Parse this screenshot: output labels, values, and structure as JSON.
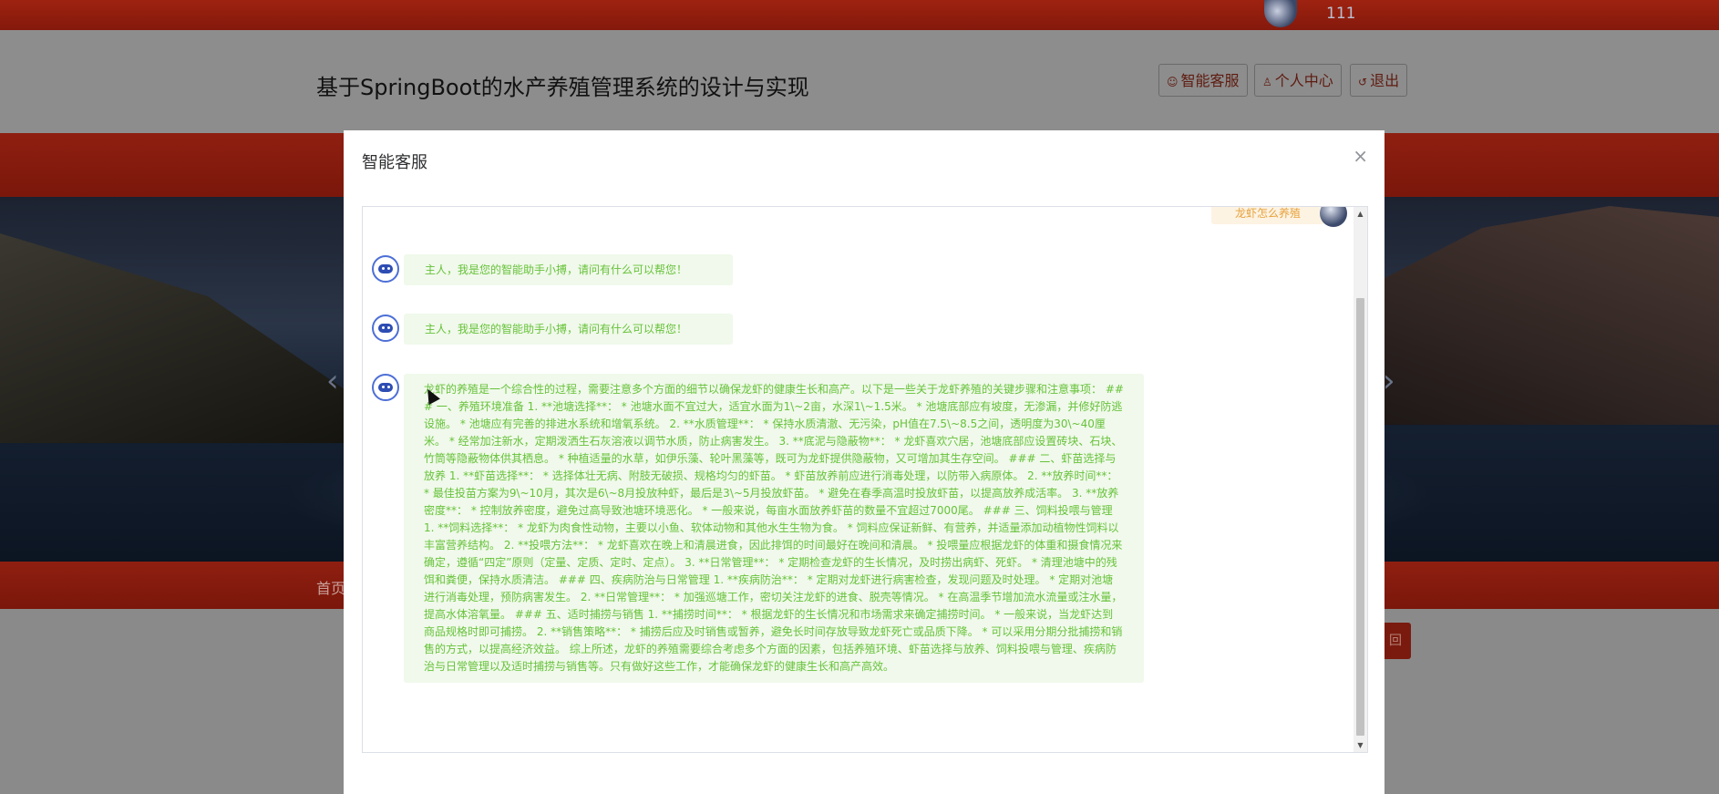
{
  "topbar": {
    "username": "111"
  },
  "header": {
    "site_title": "基于SpringBoot的水产养殖管理系统的设计与实现",
    "buttons": [
      {
        "icon": "person-icon",
        "label": "智能客服"
      },
      {
        "icon": "user-icon",
        "label": "个人中心"
      },
      {
        "icon": "logout-icon",
        "label": "退出"
      }
    ]
  },
  "nav": {
    "home": "首页"
  },
  "page": {
    "return_label": "回"
  },
  "modal": {
    "title": "智能客服",
    "close_glyph": "×",
    "user_message": "龙虾怎么养殖",
    "bot_messages": [
      "主人，我是您的智能助手小搏，请问有什么可以帮您！",
      "主人，我是您的智能助手小搏，请问有什么可以帮您！",
      "龙虾的养殖是一个综合性的过程，需要注意多个方面的细节以确保龙虾的健康生长和高产。以下是一些关于龙虾养殖的关键步骤和注意事项： ### 一、养殖环境准备 1. **池塘选择**： * 池塘水面不宜过大，适宜水面为1\\~2亩，水深1\\~1.5米。 * 池塘底部应有坡度，无渗漏，并修好防逃设施。 * 池塘应有完善的排进水系统和增氧系统。 2. **水质管理**： * 保持水质清澈、无污染，pH值在7.5\\~8.5之间，透明度为30\\~40厘米。 * 经常加注新水，定期泼洒生石灰溶液以调节水质，防止病害发生。 3. **底泥与隐蔽物**： * 龙虾喜欢穴居，池塘底部应设置砖块、石块、竹筒等隐蔽物体供其栖息。 * 种植适量的水草，如伊乐藻、轮叶黑藻等，既可为龙虾提供隐蔽物，又可增加其生存空间。 ### 二、虾苗选择与放养 1. **虾苗选择**： * 选择体壮无病、附肢无破损、规格均匀的虾苗。 * 虾苗放养前应进行消毒处理，以防带入病原体。 2. **放养时间**： * 最佳投苗方案为9\\~10月，其次是6\\~8月投放种虾，最后是3\\~5月投放虾苗。 * 避免在春季高温时投放虾苗，以提高放养成活率。 3. **放养密度**： * 控制放养密度，避免过高导致池塘环境恶化。 * 一般来说，每亩水面放养虾苗的数量不宜超过7000尾。 ### 三、饲料投喂与管理 1. **饲料选择**： * 龙虾为肉食性动物，主要以小鱼、软体动物和其他水生生物为食。 * 饲料应保证新鲜、有营养，并适量添加动植物性饲料以丰富营养结构。 2. **投喂方法**： * 龙虾喜欢在晚上和清晨进食，因此排饵的时间最好在晚间和清晨。 * 投喂量应根据龙虾的体重和摄食情况来确定，遵循“四定”原则（定量、定质、定时、定点）。 3. **日常管理**： * 定期检查龙虾的生长情况，及时捞出病虾、死虾。 * 清理池塘中的残饵和粪便，保持水质清洁。 ### 四、疾病防治与日常管理 1. **疾病防治**： * 定期对龙虾进行病害检查，发现问题及时处理。 * 定期对池塘进行消毒处理，预防病害发生。 2. **日常管理**： * 加强巡塘工作，密切关注龙虾的进食、脱壳等情况。 * 在高温季节增加流水流量或注水量，提高水体溶氧量。 ### 五、适时捕捞与销售 1. **捕捞时间**： * 根据龙虾的生长情况和市场需求来确定捕捞时间。 * 一般来说，当龙虾达到商品规格时即可捕捞。 2. **销售策略**： * 捕捞后应及时销售或暂养，避免长时间存放导致龙虾死亡或品质下降。 * 可以采用分期分批捕捞和销售的方式，以提高经济效益。 综上所述，龙虾的养殖需要综合考虑多个方面的因素，包括养殖环境、虾苗选择与放养、饲料投喂与管理、疾病防治与日常管理以及适时捕捞与销售等。只有做好这些工作，才能确保龙虾的健康生长和高产高效。"
    ]
  },
  "colors": {
    "brand_red": "#8f1f10",
    "bot_bubble_bg": "#f0f9eb",
    "bot_text": "#67c23a",
    "user_bubble_bg": "#fdf3e3",
    "user_text": "#e6a23c"
  }
}
